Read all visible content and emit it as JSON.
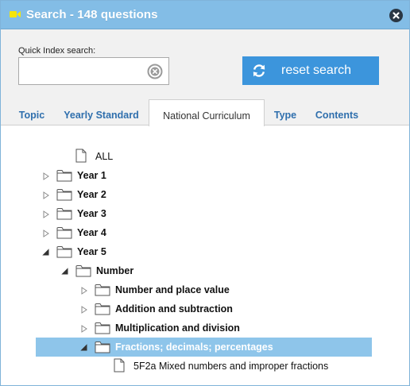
{
  "window": {
    "title": "Search - 148 questions",
    "accent_color": "#83bde6",
    "title_icon": "video-camera-icon",
    "close_icon": "close-icon"
  },
  "search": {
    "label": "Quick Index search:",
    "value": "",
    "placeholder": "",
    "clear_icon": "clear-icon",
    "reset_label": "reset search",
    "reset_icon": "refresh-icon",
    "reset_color": "#3c95dc"
  },
  "tabs": [
    {
      "label": "Topic",
      "active": false
    },
    {
      "label": "Yearly Standard",
      "active": false
    },
    {
      "label": "National Curriculum",
      "active": true
    },
    {
      "label": "Type",
      "active": false
    },
    {
      "label": "Contents",
      "active": false
    }
  ],
  "tree": [
    {
      "label": "ALL",
      "type": "file",
      "expander": "none",
      "bold": false,
      "selected": false
    },
    {
      "label": "Year 1",
      "type": "folder",
      "expander": "collapsed",
      "bold": true,
      "selected": false
    },
    {
      "label": "Year 2",
      "type": "folder",
      "expander": "collapsed",
      "bold": true,
      "selected": false
    },
    {
      "label": "Year 3",
      "type": "folder",
      "expander": "collapsed",
      "bold": true,
      "selected": false
    },
    {
      "label": "Year 4",
      "type": "folder",
      "expander": "collapsed",
      "bold": true,
      "selected": false
    },
    {
      "label": "Year 5",
      "type": "folder",
      "expander": "expanded",
      "bold": true,
      "selected": false
    },
    {
      "label": "Number",
      "type": "folder",
      "expander": "expanded",
      "bold": true,
      "selected": false
    },
    {
      "label": "Number and place value",
      "type": "folder",
      "expander": "collapsed",
      "bold": true,
      "selected": false
    },
    {
      "label": "Addition and subtraction",
      "type": "folder",
      "expander": "collapsed",
      "bold": true,
      "selected": false
    },
    {
      "label": "Multiplication and division",
      "type": "folder",
      "expander": "collapsed",
      "bold": true,
      "selected": false
    },
    {
      "label": "Fractions; decimals; percentages",
      "type": "folder",
      "expander": "expanded",
      "bold": true,
      "selected": true
    },
    {
      "label": "5F2a Mixed numbers and improper fractions",
      "type": "file",
      "expander": "none",
      "bold": false,
      "selected": false
    }
  ],
  "selection_color": "#8ec5ea"
}
